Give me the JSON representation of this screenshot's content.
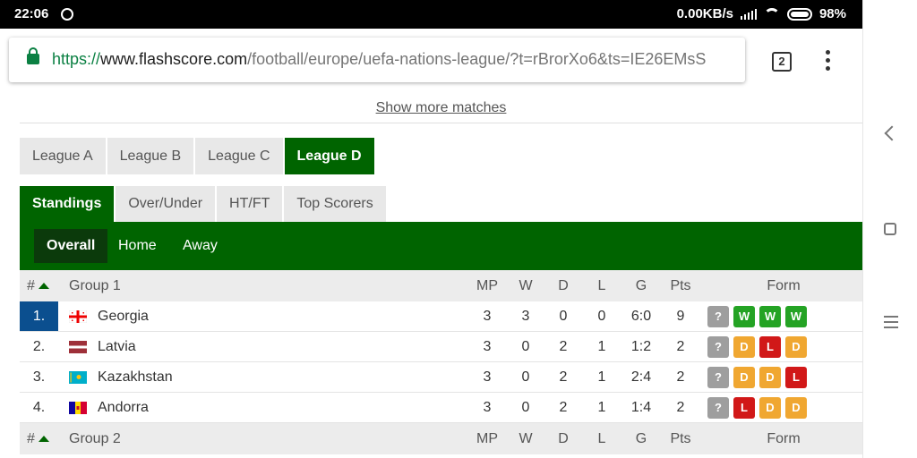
{
  "status_bar": {
    "time": "22:06",
    "network_speed": "0.00KB/s",
    "battery": "98%"
  },
  "url_bar": {
    "scheme": "https://",
    "host": "www.flashscore.com",
    "path": "/football/europe/uefa-nations-league/?t=rBrorXo6&ts=IE26EMsS",
    "tab_count": "2"
  },
  "page": {
    "show_more": "Show more matches",
    "league_tabs": [
      "League A",
      "League B",
      "League C",
      "League D"
    ],
    "active_league": "League D",
    "stat_tabs": [
      "Standings",
      "Over/Under",
      "HT/FT",
      "Top Scorers"
    ],
    "sub_tabs": [
      "Overall",
      "Home",
      "Away"
    ]
  },
  "table": {
    "headers": {
      "rank": "#",
      "mp": "MP",
      "w": "W",
      "d": "D",
      "l": "L",
      "g": "G",
      "pts": "Pts",
      "form": "Form"
    },
    "groups": [
      {
        "name": "Group 1",
        "rows": [
          {
            "rank": "1.",
            "team": "Georgia",
            "flag": "georgia",
            "mp": "3",
            "w": "3",
            "d": "0",
            "l": "0",
            "g": "6:0",
            "pts": "9",
            "form": [
              "?",
              "W",
              "W",
              "W"
            ]
          },
          {
            "rank": "2.",
            "team": "Latvia",
            "flag": "latvia",
            "mp": "3",
            "w": "0",
            "d": "2",
            "l": "1",
            "g": "1:2",
            "pts": "2",
            "form": [
              "?",
              "D",
              "L",
              "D"
            ]
          },
          {
            "rank": "3.",
            "team": "Kazakhstan",
            "flag": "kazakhstan",
            "mp": "3",
            "w": "0",
            "d": "2",
            "l": "1",
            "g": "2:4",
            "pts": "2",
            "form": [
              "?",
              "D",
              "D",
              "L"
            ]
          },
          {
            "rank": "4.",
            "team": "Andorra",
            "flag": "andorra",
            "mp": "3",
            "w": "0",
            "d": "2",
            "l": "1",
            "g": "1:4",
            "pts": "2",
            "form": [
              "?",
              "L",
              "D",
              "D"
            ]
          }
        ]
      },
      {
        "name": "Group 2",
        "rows": []
      }
    ]
  },
  "colors": {
    "brand_green": "#006400",
    "win": "#24a324",
    "draw": "#f0a731",
    "loss": "#d11818",
    "unknown": "#9e9e9e",
    "first_place": "#0b4f8f"
  }
}
